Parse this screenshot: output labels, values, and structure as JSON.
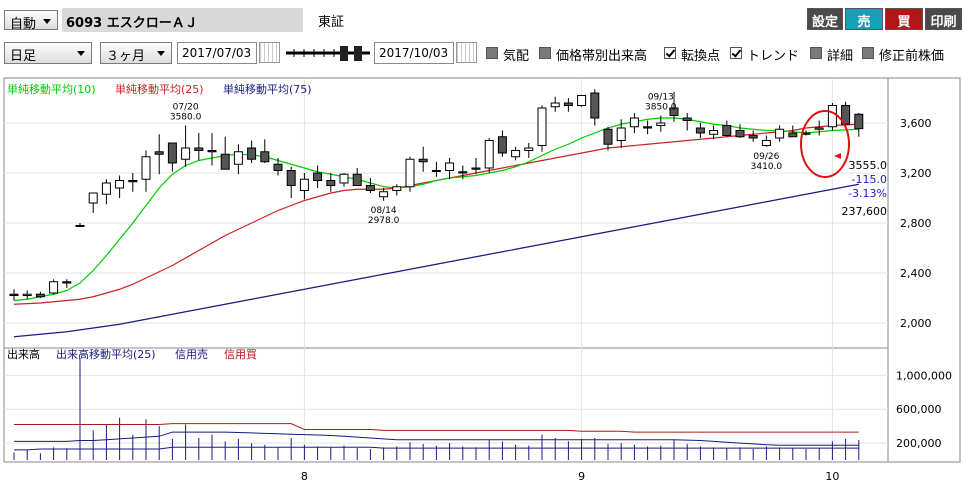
{
  "toolbar": {
    "mode": "自動",
    "ticker": "6093 エスクローＡＪ",
    "market": "東証",
    "btn_settings": "設定",
    "btn_sell": "売",
    "btn_buy": "買",
    "btn_print": "印刷",
    "interval": "日足",
    "period": "３ヶ月",
    "date_from": "2017/07/03",
    "date_to": "2017/10/03",
    "options": [
      {
        "label": "気配",
        "checked": false
      },
      {
        "label": "価格帯別出来高",
        "checked": false
      },
      {
        "label": "転換点",
        "checked": true
      },
      {
        "label": "トレンド",
        "checked": true
      },
      {
        "label": "詳細",
        "checked": false
      },
      {
        "label": "修正前株価",
        "checked": false
      }
    ]
  },
  "colors": {
    "settings_btn": "#4a4a4a",
    "sell_btn": "#1a9fb8",
    "buy_btn": "#b01818",
    "print_btn": "#4a4a4a",
    "ma10": "#00cc00",
    "ma25": "#cc2222",
    "ma75": "#1a1a80",
    "bear_candle": "#555555"
  },
  "chart_data": [
    {
      "type": "candlestick",
      "legend": [
        "単純移動平均(10)",
        "単純移動平均(25)",
        "単純移動平均(75)"
      ],
      "y_ticks": [
        "3,600",
        "3,200",
        "2,800",
        "2,400",
        "2,000"
      ],
      "y_tick_values": [
        3600,
        3200,
        2800,
        2400,
        2000
      ],
      "ylim": [
        1800,
        3960
      ],
      "x_ticks": [
        "8",
        "9",
        "10"
      ],
      "x_tick_index": [
        22,
        43,
        62
      ],
      "annotations": [
        {
          "date": "07/20",
          "value": "3580.0",
          "index": 13,
          "type": "high"
        },
        {
          "date": "08/14",
          "value": "2978.0",
          "index": 28,
          "type": "low"
        },
        {
          "date": "09/13",
          "value": "3850.0",
          "index": 49,
          "type": "high"
        },
        {
          "date": "09/26",
          "value": "3410.0",
          "index": 57,
          "type": "low"
        }
      ],
      "last_price": "3555.0",
      "change": "-115.0",
      "change_pct": "-3.13%",
      "volume": "237,600",
      "candles": [
        [
          2230,
          2270,
          2180,
          2220
        ],
        [
          2220,
          2260,
          2190,
          2230
        ],
        [
          2230,
          2250,
          2200,
          2210
        ],
        [
          2240,
          2350,
          2230,
          2330
        ],
        [
          2330,
          2350,
          2280,
          2320
        ],
        [
          2780,
          2800,
          2770,
          2780
        ],
        [
          2960,
          3030,
          2880,
          3040
        ],
        [
          3030,
          3150,
          2950,
          3120
        ],
        [
          3080,
          3180,
          3000,
          3140
        ],
        [
          3140,
          3200,
          3050,
          3130
        ],
        [
          3150,
          3380,
          3050,
          3330
        ],
        [
          3370,
          3510,
          3190,
          3350
        ],
        [
          3440,
          3440,
          3210,
          3280
        ],
        [
          3310,
          3580,
          3250,
          3400
        ],
        [
          3400,
          3520,
          3300,
          3380
        ],
        [
          3380,
          3520,
          3260,
          3370
        ],
        [
          3350,
          3490,
          3270,
          3230
        ],
        [
          3270,
          3430,
          3190,
          3370
        ],
        [
          3400,
          3460,
          3280,
          3310
        ],
        [
          3370,
          3470,
          3280,
          3290
        ],
        [
          3270,
          3320,
          3180,
          3220
        ],
        [
          3220,
          3250,
          3000,
          3100
        ],
        [
          3060,
          3200,
          2990,
          3150
        ],
        [
          3200,
          3260,
          3080,
          3140
        ],
        [
          3140,
          3200,
          3050,
          3100
        ],
        [
          3120,
          3200,
          3090,
          3190
        ],
        [
          3190,
          3240,
          3120,
          3100
        ],
        [
          3100,
          3160,
          3040,
          3060
        ],
        [
          3010,
          3080,
          2978,
          3050
        ],
        [
          3060,
          3110,
          3020,
          3090
        ],
        [
          3090,
          3330,
          3050,
          3310
        ],
        [
          3310,
          3410,
          3210,
          3290
        ],
        [
          3220,
          3290,
          3170,
          3220
        ],
        [
          3220,
          3320,
          3150,
          3280
        ],
        [
          3210,
          3260,
          3150,
          3200
        ],
        [
          3240,
          3320,
          3190,
          3230
        ],
        [
          3240,
          3480,
          3200,
          3460
        ],
        [
          3490,
          3540,
          3330,
          3360
        ],
        [
          3330,
          3410,
          3300,
          3380
        ],
        [
          3380,
          3440,
          3320,
          3400
        ],
        [
          3420,
          3740,
          3370,
          3720
        ],
        [
          3730,
          3810,
          3690,
          3760
        ],
        [
          3760,
          3800,
          3690,
          3740
        ],
        [
          3740,
          3820,
          3730,
          3820
        ],
        [
          3840,
          3870,
          3580,
          3640
        ],
        [
          3550,
          3570,
          3380,
          3430
        ],
        [
          3460,
          3630,
          3400,
          3560
        ],
        [
          3570,
          3680,
          3520,
          3640
        ],
        [
          3570,
          3620,
          3510,
          3560
        ],
        [
          3580,
          3660,
          3530,
          3600
        ],
        [
          3720,
          3850,
          3610,
          3660
        ],
        [
          3640,
          3680,
          3540,
          3620
        ],
        [
          3560,
          3600,
          3480,
          3520
        ],
        [
          3510,
          3580,
          3470,
          3540
        ],
        [
          3580,
          3620,
          3490,
          3500
        ],
        [
          3540,
          3590,
          3480,
          3490
        ],
        [
          3500,
          3540,
          3450,
          3480
        ],
        [
          3420,
          3500,
          3410,
          3460
        ],
        [
          3480,
          3580,
          3450,
          3550
        ],
        [
          3520,
          3580,
          3490,
          3490
        ],
        [
          3520,
          3540,
          3500,
          3510
        ],
        [
          3550,
          3620,
          3500,
          3560
        ],
        [
          3570,
          3760,
          3540,
          3740
        ],
        [
          3740,
          3770,
          3570,
          3590
        ],
        [
          3670,
          3680,
          3490,
          3555
        ]
      ],
      "ma10": [
        2180,
        2190,
        2210,
        2230,
        2260,
        2320,
        2420,
        2540,
        2670,
        2800,
        2940,
        3080,
        3190,
        3260,
        3300,
        3320,
        3340,
        3350,
        3345,
        3330,
        3300,
        3270,
        3240,
        3210,
        3190,
        3170,
        3150,
        3120,
        3090,
        3080,
        3090,
        3110,
        3140,
        3160,
        3170,
        3180,
        3200,
        3220,
        3250,
        3290,
        3340,
        3390,
        3430,
        3480,
        3520,
        3560,
        3590,
        3610,
        3630,
        3640,
        3640,
        3630,
        3610,
        3590,
        3580,
        3560,
        3550,
        3540,
        3540,
        3530,
        3520,
        3530,
        3540,
        3545,
        3550
      ],
      "ma25": [
        2150,
        2155,
        2160,
        2170,
        2180,
        2190,
        2210,
        2240,
        2270,
        2310,
        2360,
        2410,
        2460,
        2520,
        2580,
        2640,
        2700,
        2750,
        2800,
        2850,
        2900,
        2940,
        2980,
        3010,
        3040,
        3060,
        3070,
        3070,
        3070,
        3080,
        3100,
        3120,
        3140,
        3160,
        3180,
        3200,
        3220,
        3240,
        3260,
        3280,
        3300,
        3320,
        3340,
        3360,
        3380,
        3400,
        3410,
        3420,
        3430,
        3440,
        3450,
        3460,
        3470,
        3480,
        3490,
        3500,
        3510,
        3520,
        3530,
        3540,
        3560,
        3570,
        3580,
        3585,
        3590
      ],
      "ma75": [
        1890,
        1900,
        1910,
        1920,
        1930,
        1945,
        1960,
        1975,
        1990,
        2010,
        2030,
        2050,
        2070,
        2090,
        2110,
        2130,
        2150,
        2170,
        2190,
        2210,
        2230,
        2250,
        2270,
        2290,
        2310,
        2330,
        2350,
        2370,
        2390,
        2410,
        2430,
        2450,
        2470,
        2490,
        2510,
        2530,
        2550,
        2570,
        2590,
        2610,
        2630,
        2650,
        2670,
        2690,
        2710,
        2730,
        2750,
        2770,
        2790,
        2810,
        2830,
        2850,
        2870,
        2890,
        2910,
        2930,
        2950,
        2970,
        2990,
        3010,
        3030,
        3050,
        3070,
        3090,
        3110
      ]
    },
    {
      "type": "bar",
      "legend": [
        "出来高",
        "出来高移動平均(25)",
        "信用売",
        "信用買"
      ],
      "y_ticks": [
        "1,000,000",
        "600,000",
        "200,000"
      ],
      "y_tick_values": [
        1000000,
        600000,
        200000
      ],
      "ylim": [
        0,
        1300000
      ],
      "volume": [
        90000,
        120000,
        80000,
        150000,
        140000,
        1200000,
        350000,
        420000,
        500000,
        300000,
        480000,
        400000,
        250000,
        420000,
        260000,
        300000,
        220000,
        250000,
        200000,
        180000,
        150000,
        260000,
        180000,
        160000,
        150000,
        170000,
        140000,
        130000,
        150000,
        160000,
        210000,
        190000,
        170000,
        200000,
        160000,
        150000,
        240000,
        220000,
        180000,
        170000,
        300000,
        260000,
        220000,
        250000,
        260000,
        190000,
        200000,
        180000,
        160000,
        170000,
        240000,
        190000,
        160000,
        150000,
        140000,
        150000,
        130000,
        160000,
        150000,
        140000,
        130000,
        140000,
        220000,
        250000,
        237600
      ],
      "vol_ma25": [
        220000,
        220000,
        220000,
        220000,
        220000,
        230000,
        230000,
        240000,
        250000,
        260000,
        270000,
        280000,
        330000,
        330000,
        330000,
        330000,
        330000,
        325000,
        320000,
        315000,
        310000,
        305000,
        300000,
        295000,
        290000,
        280000,
        270000,
        260000,
        250000,
        240000,
        240000,
        240000,
        240000,
        240000,
        240000,
        240000,
        240000,
        240000,
        240000,
        240000,
        240000,
        240000,
        240000,
        240000,
        240000,
        240000,
        240000,
        240000,
        240000,
        240000,
        240000,
        235000,
        230000,
        220000,
        210000,
        200000,
        190000,
        180000,
        175000,
        175000,
        175000,
        175000,
        175000,
        175000,
        175000
      ],
      "margin_sell": [
        120000,
        120000,
        130000,
        130000,
        130000,
        130000,
        130000,
        130000,
        130000,
        130000,
        130000,
        130000,
        150000,
        150000,
        150000,
        150000,
        150000,
        150000,
        150000,
        150000,
        150000,
        150000,
        150000,
        150000,
        150000,
        150000,
        150000,
        150000,
        140000,
        140000,
        140000,
        140000,
        140000,
        140000,
        140000,
        140000,
        140000,
        140000,
        140000,
        140000,
        140000,
        140000,
        140000,
        140000,
        140000,
        140000,
        140000,
        140000,
        140000,
        140000,
        140000,
        140000,
        140000,
        140000,
        140000,
        140000,
        140000,
        140000,
        140000,
        140000,
        140000,
        140000,
        140000,
        140000,
        140000
      ],
      "margin_buy": [
        420000,
        420000,
        420000,
        420000,
        420000,
        420000,
        420000,
        420000,
        420000,
        420000,
        420000,
        420000,
        430000,
        430000,
        430000,
        430000,
        430000,
        430000,
        430000,
        430000,
        430000,
        430000,
        360000,
        360000,
        360000,
        360000,
        360000,
        360000,
        350000,
        350000,
        350000,
        350000,
        350000,
        350000,
        350000,
        350000,
        350000,
        350000,
        350000,
        350000,
        350000,
        350000,
        350000,
        340000,
        340000,
        340000,
        340000,
        330000,
        330000,
        330000,
        330000,
        330000,
        330000,
        330000,
        330000,
        330000,
        330000,
        330000,
        330000,
        330000,
        330000,
        330000,
        330000,
        330000,
        330000
      ]
    }
  ]
}
